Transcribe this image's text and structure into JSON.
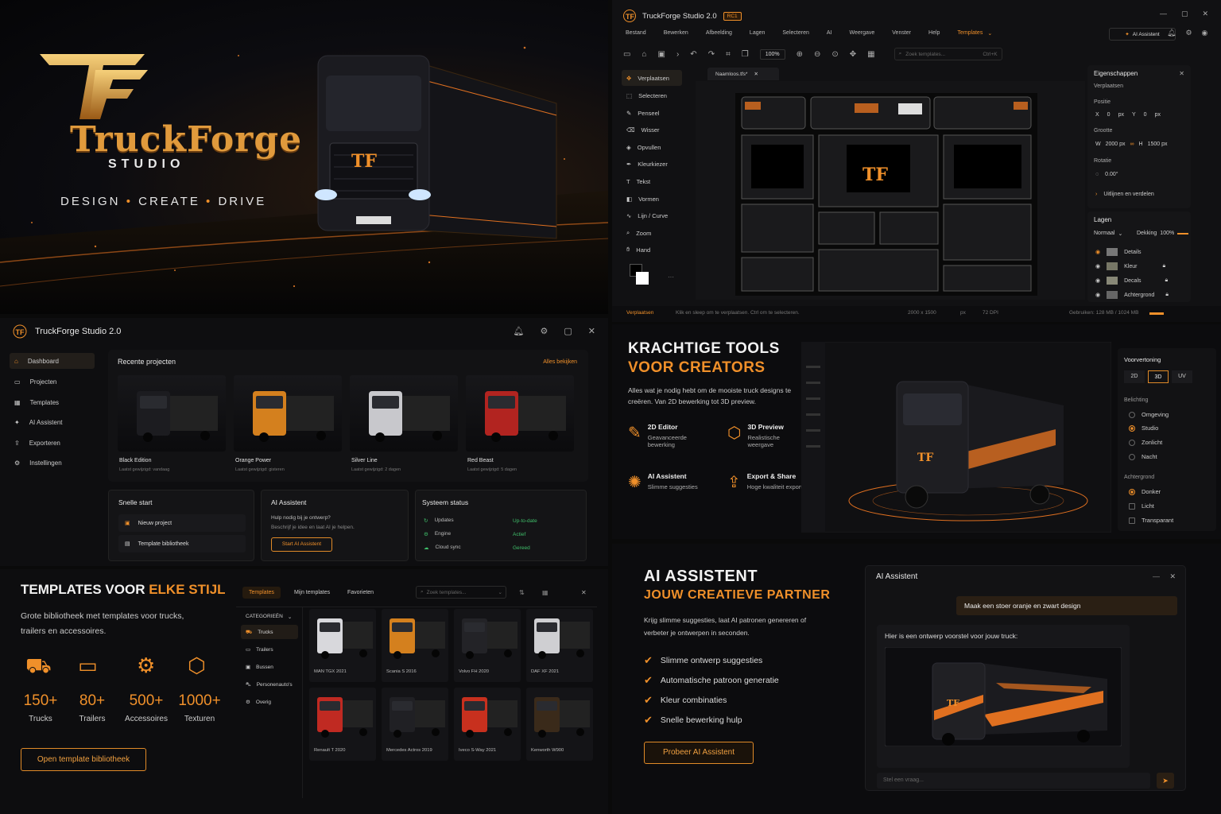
{
  "hero": {
    "brand": "TruckForge",
    "studio": "STUDIO",
    "tagline": [
      "DESIGN",
      "CREATE",
      "DRIVE"
    ]
  },
  "editor": {
    "title": "TruckForge Studio 2.0",
    "badge": "RC1",
    "menu": [
      "Bestand",
      "Bewerken",
      "Afbeelding",
      "Lagen",
      "Selecteren",
      "AI",
      "Weergave",
      "Venster",
      "Help",
      "Templates"
    ],
    "ai_button": "AI Assistent",
    "zoom": "100%",
    "search_placeholder": "Zoek templates...",
    "search_shortcut": "Ctrl+K",
    "tab": "Naamloos.tfs*",
    "tools": [
      "Verplaatsen",
      "Selecteren",
      "Penseel",
      "Wisser",
      "Opvullen",
      "Kleurkiezer",
      "Tekst",
      "Vormen",
      "Lijn / Curve",
      "Zoom",
      "Hand"
    ],
    "props": {
      "title": "Eigenschappen",
      "subtitle": "Verplaatsen",
      "positie": "Positie",
      "x_label": "X",
      "x_val": "0",
      "x_unit": "px",
      "y_label": "Y",
      "y_val": "0",
      "y_unit": "px",
      "grootte": "Grootte",
      "w_label": "W",
      "w_val": "2000 px",
      "h_label": "H",
      "h_val": "1500 px",
      "rotatie": "Rotatie",
      "rot_val": "0.00°",
      "align": "Uitlijnen en verdelen"
    },
    "layers": {
      "title": "Lagen",
      "mode": "Normaal",
      "opacity_label": "Dekking",
      "opacity": "100%",
      "items": [
        "Details",
        "Kleur",
        "Decals",
        "Achtergrond"
      ]
    },
    "status": {
      "tool": "Verplaatsen",
      "hint": "Klik en sleep om te verplaatsen. Ctrl om te selecteren.",
      "size": "2000 x 1500",
      "unit": "px",
      "dpi": "72 DPI",
      "memory": "Gebruiken: 128 MB / 1024 MB"
    }
  },
  "dashboard": {
    "title": "TruckForge Studio 2.0",
    "nav": [
      "Dashboard",
      "Projecten",
      "Templates",
      "AI Assistent",
      "Exporteren",
      "Instellingen"
    ],
    "recent_title": "Recente projecten",
    "view_all": "Alles bekijken",
    "projects": [
      {
        "name": "Black Edition",
        "meta": "Laatst gewijzigd: vandaag"
      },
      {
        "name": "Orange Power",
        "meta": "Laatst gewijzigd: gisteren"
      },
      {
        "name": "Silver Line",
        "meta": "Laatst gewijzigd: 2 dagen"
      },
      {
        "name": "Red Beast",
        "meta": "Laatst gewijzigd: 5 dagen"
      }
    ],
    "quick_title": "Snelle start",
    "quick": [
      "Nieuw project",
      "Template bibliotheek"
    ],
    "ai_title": "AI Assistent",
    "ai_q": "Hulp nodig bij je ontwerp?",
    "ai_desc": "Beschrijf je idee en laat AI je helpen.",
    "ai_btn": "Start AI Assistent",
    "sys_title": "Systeem status",
    "sys": [
      {
        "label": "Updates",
        "value": "Up-to-date"
      },
      {
        "label": "Engine",
        "value": "Actief"
      },
      {
        "label": "Cloud sync",
        "value": "Gereed"
      }
    ]
  },
  "tools_panel": {
    "title1": "KRACHTIGE TOOLS",
    "title2": "VOOR CREATORS",
    "desc": "Alles wat je nodig hebt om de mooiste truck designs te creëren. Van 2D bewerking tot 3D preview.",
    "features": [
      {
        "title": "2D Editor",
        "desc": "Geavanceerde bewerking"
      },
      {
        "title": "3D Preview",
        "desc": "Realistische weergave"
      },
      {
        "title": "AI Assistent",
        "desc": "Slimme suggesties"
      },
      {
        "title": "Export & Share",
        "desc": "Hoge kwaliteit export"
      }
    ],
    "preview": {
      "title": "Voorvertoning",
      "modes": [
        "2D",
        "3D",
        "UV"
      ],
      "lighting_title": "Belichting",
      "lighting": [
        "Omgeving",
        "Studio",
        "Zonlicht",
        "Nacht"
      ],
      "bg_title": "Achtergrond",
      "bg": [
        "Donker",
        "Licht",
        "Transparant"
      ]
    }
  },
  "templates": {
    "title_a": "TEMPLATES VOOR ",
    "title_b": "ELKE STIJL",
    "desc": "Grote bibliotheek met templates voor trucks, trailers en accessoires.",
    "stats": [
      {
        "value": "150+",
        "label": "Trucks"
      },
      {
        "value": "80+",
        "label": "Trailers"
      },
      {
        "value": "500+",
        "label": "Accessoires"
      },
      {
        "value": "1000+",
        "label": "Texturen"
      }
    ],
    "open_btn": "Open template bibliotheek",
    "tabs": [
      "Templates",
      "Mijn templates",
      "Favorieten"
    ],
    "search_placeholder": "Zoek templates...",
    "categories_title": "CATEGORIEËN",
    "categories": [
      "Trucks",
      "Trailers",
      "Bussen",
      "Personenauto's",
      "Overig"
    ],
    "items": [
      "MAN TGX 2021",
      "Scania S 2016",
      "Volvo FH 2020",
      "DAF XF 2021",
      "Renault T 2020",
      "Mercedes Actros 2019",
      "Iveco S-Way 2021",
      "Kenworth W900"
    ]
  },
  "ai_panel": {
    "title1": "AI ASSISTENT",
    "title2": "JOUW CREATIEVE PARTNER",
    "desc": "Krijg slimme suggesties, laat AI patronen genereren of verbeter je ontwerpen in seconden.",
    "checks": [
      "Slimme ontwerp suggesties",
      "Automatische patroon generatie",
      "Kleur combinaties",
      "Snelle bewerking hulp"
    ],
    "btn": "Probeer AI Assistent",
    "chat_title": "AI Assistent",
    "user_msg": "Maak een stoer oranje en zwart design",
    "reply": "Hier is een ontwerp voorstel voor jouw truck:",
    "input_placeholder": "Stel een vraag..."
  },
  "colors": {
    "accent": "#f0902a",
    "bg": "#0d0d0f",
    "ok": "#3fbf6a"
  }
}
